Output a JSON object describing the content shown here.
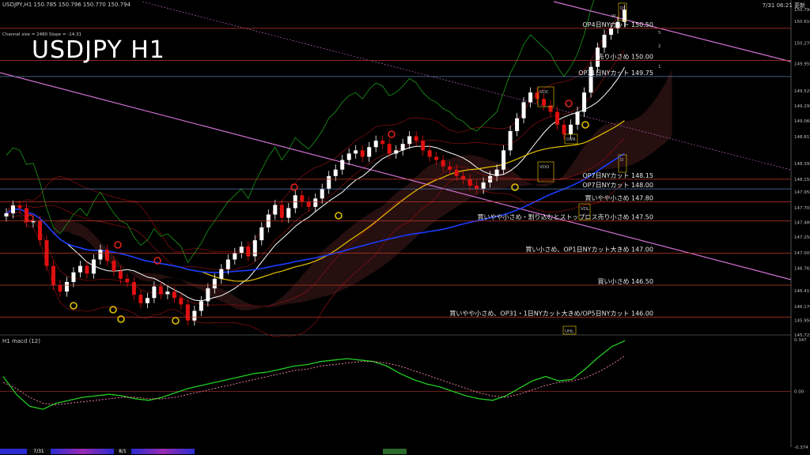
{
  "header": {
    "symbol_line": "USDJPY,H1  150.785 150.796 150.770 150.794",
    "channel_info": "Channel size = 2480 Slope = -14.31",
    "update_time": "7/31 06:21 更新",
    "title": "USDJPY H1"
  },
  "colors": {
    "background": "#000000",
    "candle_up": "#ffffff",
    "candle_down": "#e01010",
    "ma_fast": "#ffffff",
    "ma_mid": "#e6c200",
    "ma_slow": "#1a3cff",
    "channel": "#d070d0",
    "macd_main": "#22cc22",
    "macd_signal": "#ff88aa",
    "level_line": "#c0392b",
    "level_line_alt": "#5577aa"
  },
  "chart_data": [
    {
      "type": "candlestick",
      "title": "USDJPY H1",
      "ylim": [
        145.725,
        150.794
      ],
      "y_ticks": [
        "150.794",
        "150.610",
        "150.270",
        "149.950",
        "149.525",
        "149.295",
        "149.060",
        "148.815",
        "148.395",
        "148.150",
        "147.950",
        "147.705",
        "147.480",
        "147.250",
        "147.005",
        "146.765",
        "146.415",
        "146.170",
        "145.950",
        "145.725"
      ],
      "x_ticks": [
        "7/31",
        "8/1"
      ],
      "closes": [
        147.62,
        147.74,
        147.7,
        147.48,
        147.5,
        147.2,
        146.8,
        146.5,
        146.4,
        146.55,
        146.7,
        146.8,
        146.68,
        146.9,
        147.05,
        146.88,
        146.72,
        146.6,
        146.55,
        146.35,
        146.22,
        146.3,
        146.48,
        146.36,
        146.4,
        146.3,
        146.2,
        145.95,
        146.1,
        146.25,
        146.45,
        146.6,
        146.75,
        146.9,
        147.0,
        147.1,
        146.95,
        147.2,
        147.4,
        147.6,
        147.75,
        147.55,
        147.7,
        147.9,
        147.8,
        147.72,
        147.85,
        148.0,
        148.2,
        148.3,
        148.45,
        148.55,
        148.6,
        148.5,
        148.65,
        148.75,
        148.7,
        148.55,
        148.6,
        148.7,
        148.82,
        148.75,
        148.6,
        148.5,
        148.45,
        148.35,
        148.3,
        148.2,
        148.15,
        148.05,
        148.0,
        148.1,
        148.2,
        148.3,
        148.6,
        148.9,
        149.1,
        149.35,
        149.5,
        149.4,
        149.3,
        149.2,
        149.0,
        148.85,
        149.0,
        149.2,
        149.5,
        149.9,
        150.2,
        150.4,
        150.5,
        150.6,
        150.79
      ],
      "macd": {
        "main": [
          0.1,
          -0.02,
          -0.1,
          -0.12,
          -0.08,
          -0.06,
          -0.04,
          -0.03,
          -0.02,
          -0.03,
          -0.05,
          -0.06,
          -0.04,
          -0.01,
          0.02,
          0.04,
          0.06,
          0.08,
          0.1,
          0.12,
          0.13,
          0.15,
          0.17,
          0.18,
          0.2,
          0.21,
          0.22,
          0.21,
          0.2,
          0.17,
          0.12,
          0.08,
          0.05,
          0.03,
          0.0,
          -0.03,
          -0.05,
          -0.06,
          -0.03,
          0.02,
          0.07,
          0.1,
          0.07,
          0.08,
          0.15,
          0.23,
          0.3,
          0.34
        ],
        "signal": [
          0.06,
          0.02,
          -0.04,
          -0.08,
          -0.09,
          -0.08,
          -0.07,
          -0.06,
          -0.05,
          -0.04,
          -0.04,
          -0.05,
          -0.05,
          -0.04,
          -0.02,
          0.0,
          0.02,
          0.04,
          0.06,
          0.08,
          0.1,
          0.12,
          0.14,
          0.15,
          0.17,
          0.18,
          0.19,
          0.2,
          0.2,
          0.19,
          0.17,
          0.14,
          0.11,
          0.08,
          0.05,
          0.02,
          -0.01,
          -0.03,
          -0.04,
          -0.02,
          0.01,
          0.04,
          0.06,
          0.07,
          0.09,
          0.13,
          0.18,
          0.24
        ],
        "ylim": [
          -0.374,
          0.347
        ],
        "ticks": [
          "0.347",
          "0.00",
          "-0.374"
        ],
        "label": "H1  macd (12)"
      }
    }
  ],
  "levels": [
    {
      "price": 150.5,
      "label": "OP4日NYカット 150.50",
      "color": "#c0392b"
    },
    {
      "price": 150.0,
      "label": "売り小さめ 150.00",
      "color": "#c0392b"
    },
    {
      "price": 149.75,
      "label": "OP31日NYカット 149.75",
      "color": "#5577aa"
    },
    {
      "price": 148.15,
      "label": "OP7日NYカット 148.15",
      "color": "#c0392b"
    },
    {
      "price": 148.0,
      "label": "OP7日NYカット 148.00",
      "color": "#5577aa"
    },
    {
      "price": 147.8,
      "label": "買いやや小さめ 147.80",
      "color": "#c0392b"
    },
    {
      "price": 147.5,
      "label": "買いやや小さめ・割り込むとストップロス売り小さめ 147.50",
      "color": "#c0392b"
    },
    {
      "price": 147.0,
      "label": "買い小さめ、OP1日NYカット大きめ 147.00",
      "color": "#c0392b"
    },
    {
      "price": 146.5,
      "label": "買い小さめ 146.50",
      "color": "#c0392b"
    },
    {
      "price": 146.0,
      "label": "買いやや小さめ、OP31・1日NYカット大きめ/OP5日NYカット 146.00",
      "color": "#c0392b"
    }
  ],
  "markers": {
    "vdc": "VDC",
    "vdo": "VDO",
    "vdl": "VDL",
    "uhl": "UHL",
    "ovr": "OVR",
    "d": "D",
    "w": "W",
    "num5": "5",
    "num2": "2",
    "num1": "1"
  },
  "bottom_tabs": [
    "7/31",
    "8/1"
  ]
}
